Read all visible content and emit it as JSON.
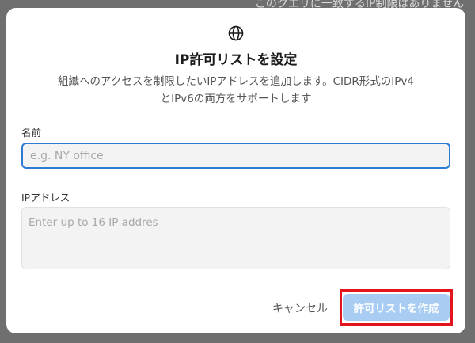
{
  "backdrop": {
    "text": "このクエリに一致するIP制限はありません"
  },
  "modal": {
    "icon": "globe-icon",
    "title": "IP許可リストを設定",
    "description": "組織へのアクセスを制限したいIPアドレスを追加します。CIDR形式のIPv4とIPv6の両方をサポートします",
    "name_field": {
      "label": "名前",
      "value": "",
      "placeholder": "e.g. NY office"
    },
    "ip_field": {
      "label": "IPアドレス",
      "value": "",
      "placeholder": "Enter up to 16 IP addres"
    },
    "cancel_label": "キャンセル",
    "submit_label": "許可リストを作成"
  },
  "colors": {
    "primary_disabled": "#a9cdf2",
    "focus_border": "#2e7bd6",
    "highlight": "#e3141c"
  }
}
